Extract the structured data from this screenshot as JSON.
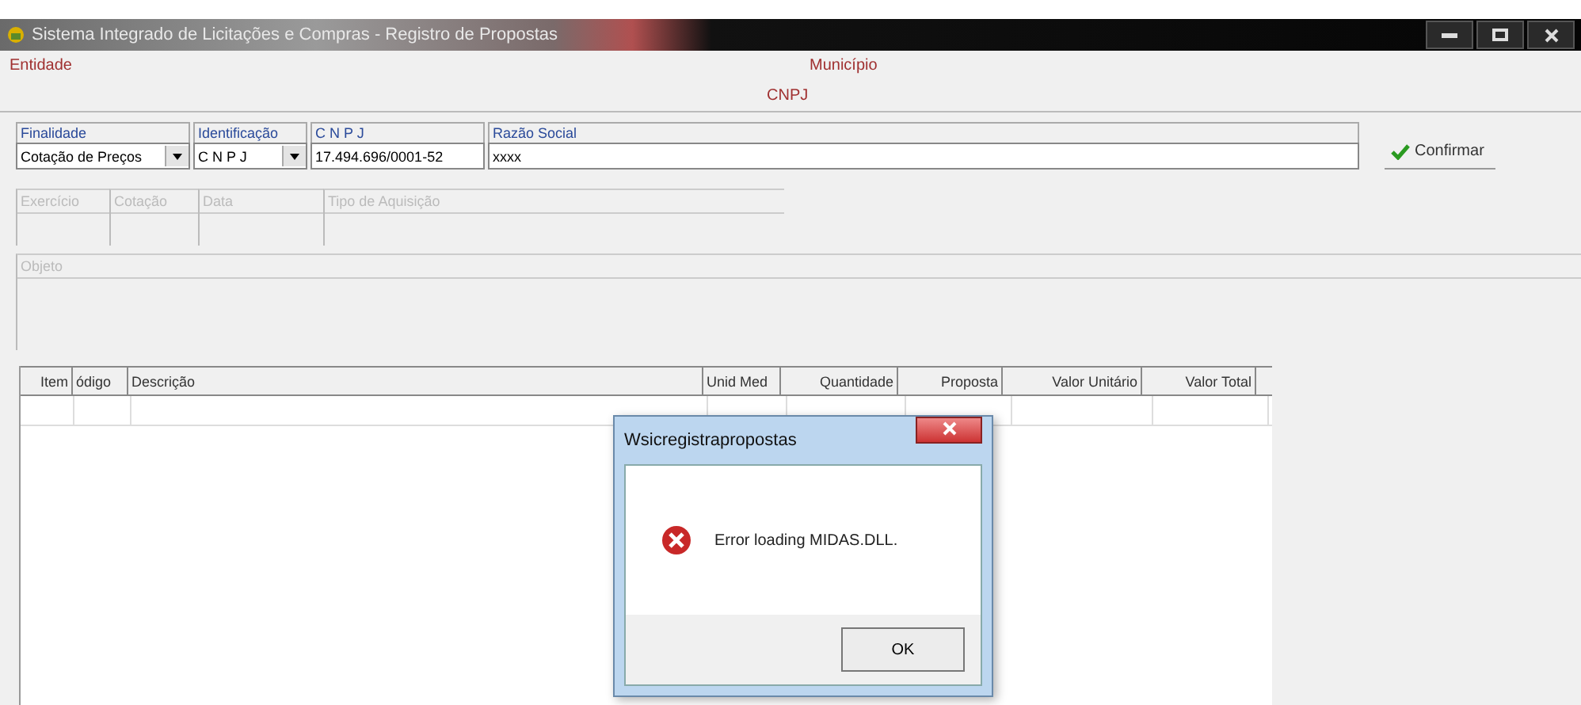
{
  "window": {
    "title": "Sistema Integrado de Licitações e Compras - Registro de Propostas"
  },
  "header": {
    "entidade": "Entidade",
    "municipio": "Município",
    "cnpj": "CNPJ"
  },
  "fields": [
    {
      "kind": "select",
      "label": "Finalidade",
      "value": "Cotação de Preços"
    },
    {
      "kind": "select",
      "label": "Identificação",
      "value": "C N P J"
    },
    {
      "kind": "text",
      "label": "C N P J",
      "value": "17.494.696/0001-52"
    },
    {
      "kind": "text",
      "label": "Razão Social",
      "value": "xxxx"
    }
  ],
  "confirm_button": "Confirmar",
  "info_fields": [
    "Exercício",
    "Cotação",
    "Data",
    "Tipo de Aquisição"
  ],
  "objeto": "Objeto",
  "table": {
    "columns": [
      "Item",
      "ódigo",
      "Descrição",
      "Unid Med",
      "Quantidade",
      "Proposta",
      "Valor Unitário",
      "Valor Total"
    ]
  },
  "dialog": {
    "title": "Wsicregistrapropostas",
    "message": "Error loading MIDAS.DLL.",
    "button": "OK"
  }
}
